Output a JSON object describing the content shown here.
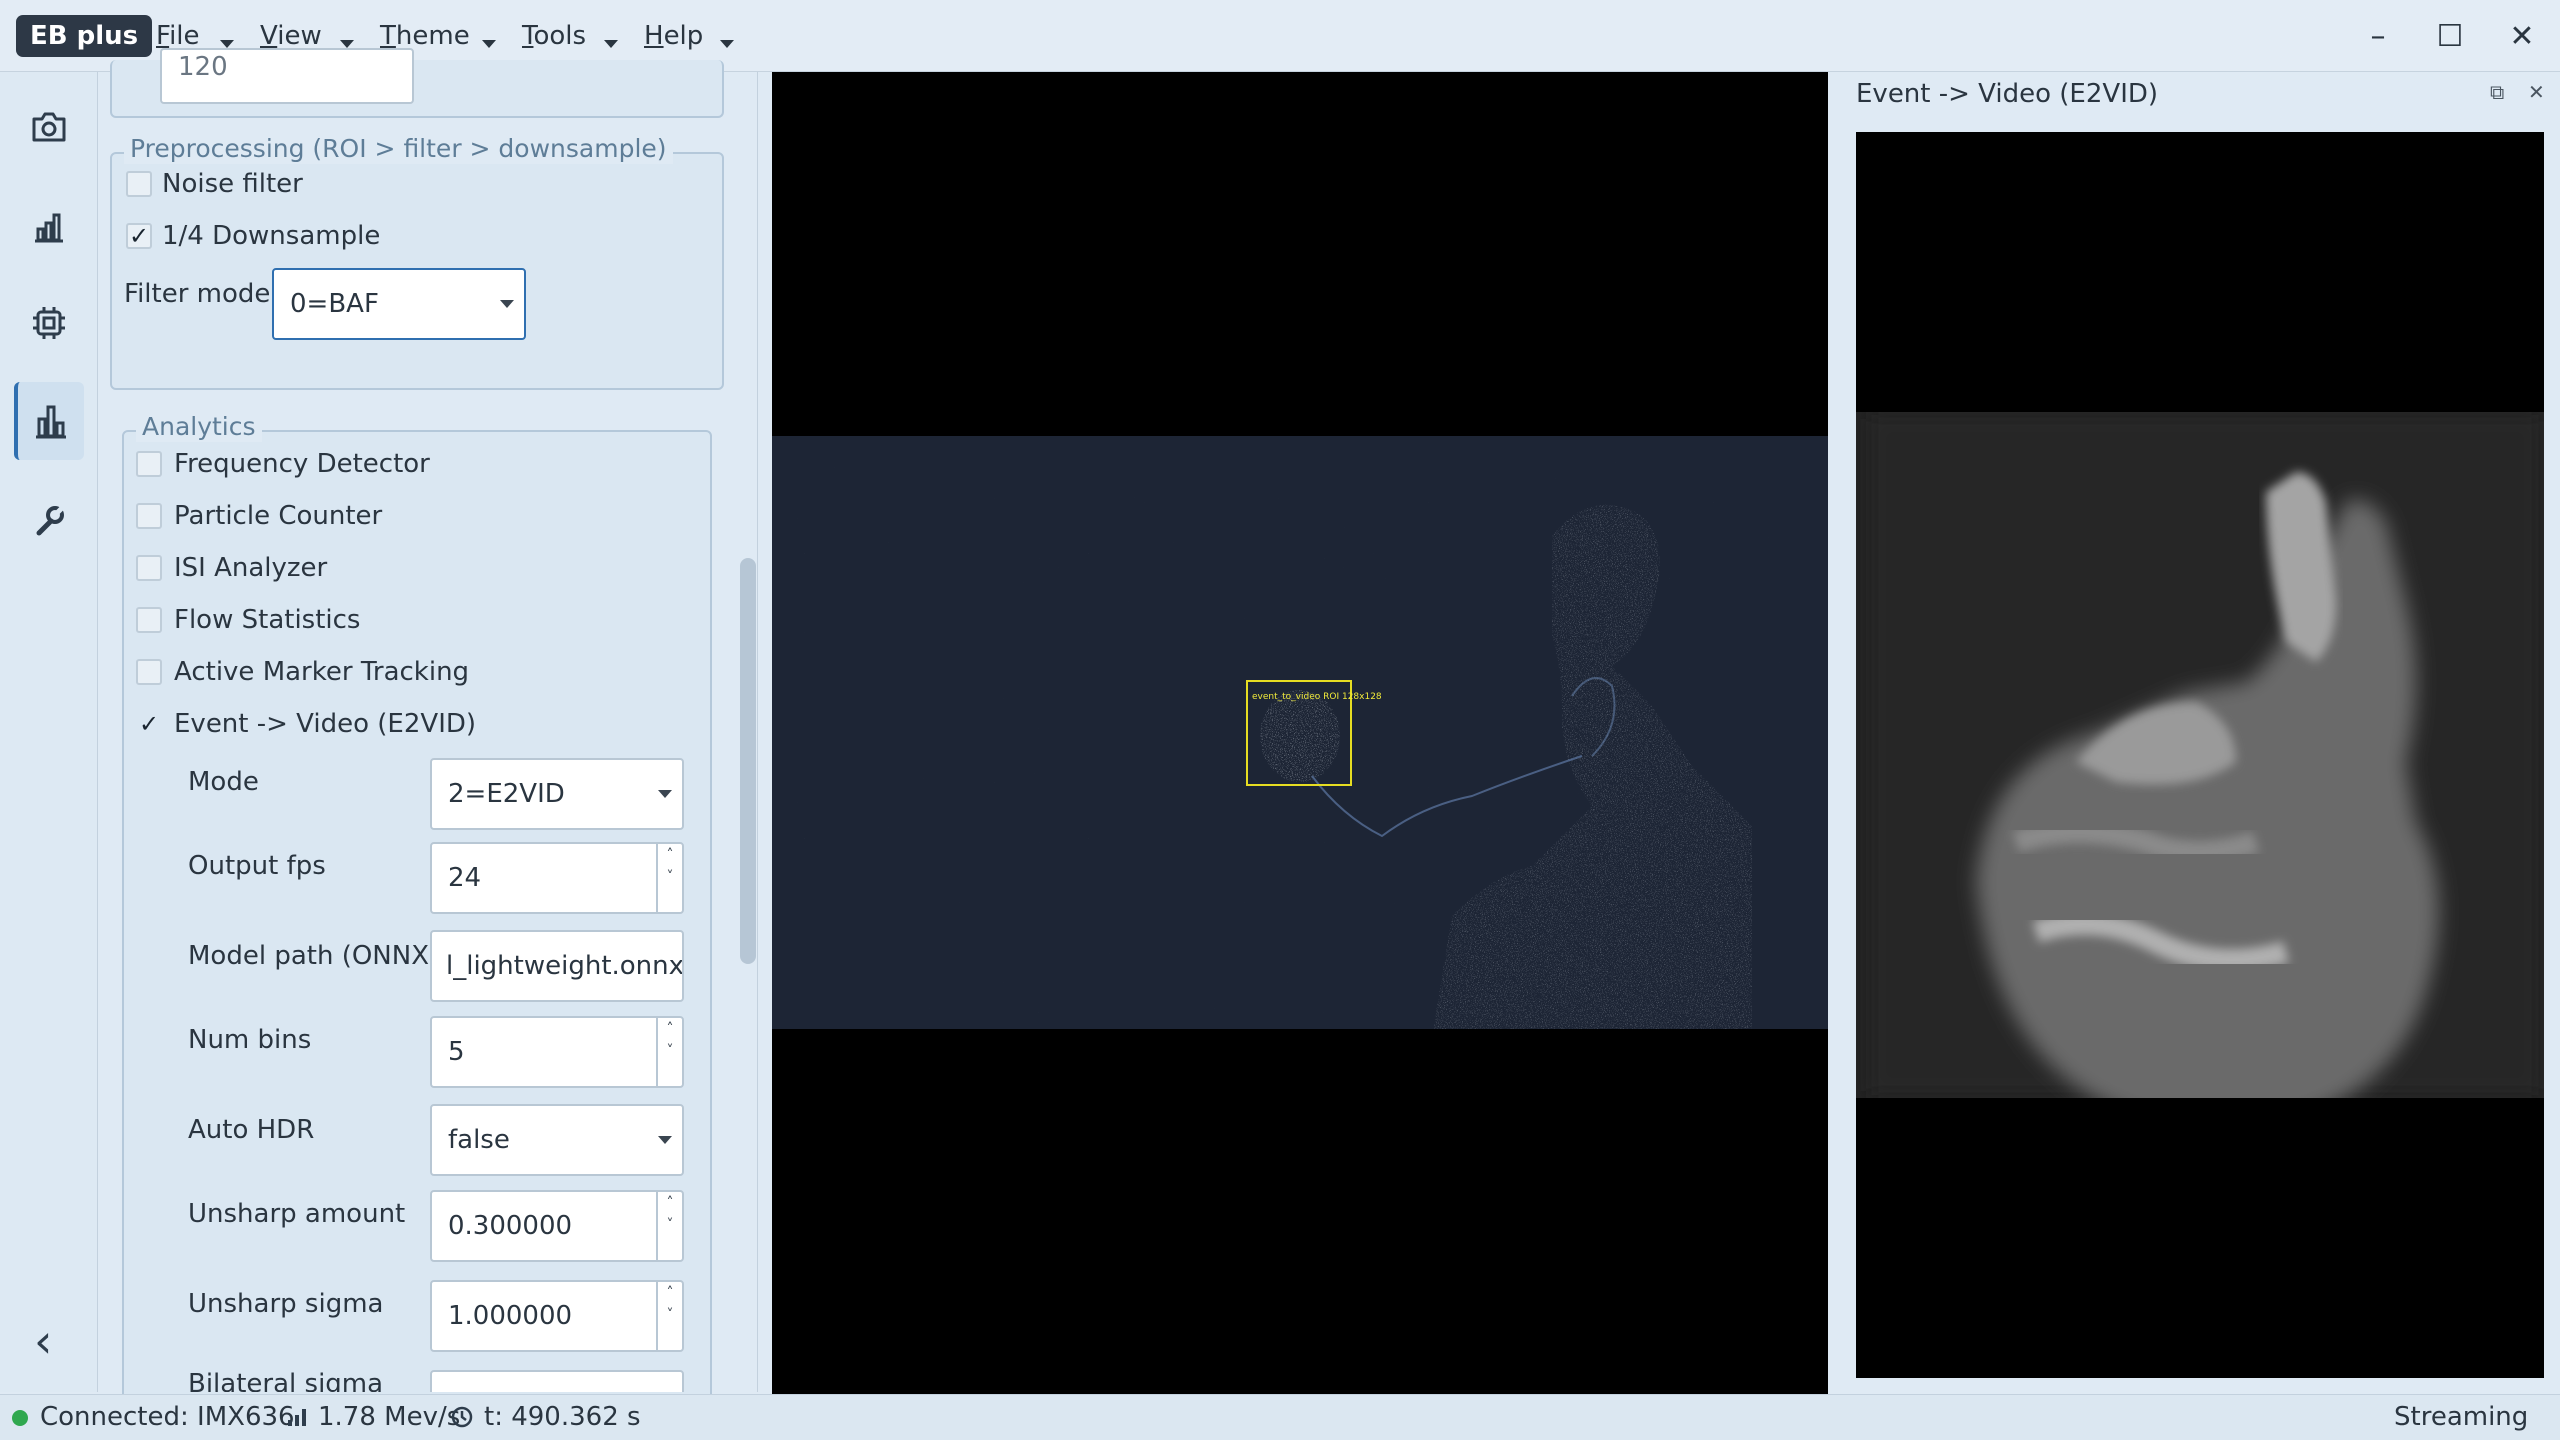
{
  "app": {
    "badge": "EB plus"
  },
  "menu": {
    "items": [
      {
        "label_u": "F",
        "label_rest": "ile"
      },
      {
        "label_u": "V",
        "label_rest": "iew"
      },
      {
        "label_u": "T",
        "label_rest": "heme"
      },
      {
        "label_u": "T",
        "label_rest": "ools"
      },
      {
        "label_u": "H",
        "label_rest": "elp"
      }
    ]
  },
  "window_controls": {
    "minimize": "–",
    "maximize": "☐",
    "close": "✕"
  },
  "rail": {
    "icons": [
      "camera-icon",
      "bar-chart-icon",
      "chip-icon",
      "analytics-icon",
      "wrench-icon"
    ],
    "active_index": 3,
    "collapse_glyph": "‹"
  },
  "panel": {
    "top_spin_value": "120",
    "preprocessing": {
      "title": "Preprocessing (ROI > filter > downsample)",
      "noise_filter": {
        "label": "Noise filter",
        "checked": false
      },
      "downsample": {
        "label": "1/4 Downsample",
        "checked": true
      },
      "filter_mode": {
        "label": "Filter mode",
        "value": "0=BAF"
      }
    },
    "analytics": {
      "title": "Analytics",
      "items": [
        {
          "label": "Frequency Detector",
          "checked": false
        },
        {
          "label": "Particle Counter",
          "checked": false
        },
        {
          "label": "ISI Analyzer",
          "checked": false
        },
        {
          "label": "Flow Statistics",
          "checked": false
        },
        {
          "label": "Active Marker Tracking",
          "checked": false
        },
        {
          "label": "Event -> Video (E2VID)",
          "checked": true
        }
      ],
      "check_glyph": "✓",
      "params": {
        "mode": {
          "label": "Mode",
          "value": "2=E2VID"
        },
        "output_fps": {
          "label": "Output fps",
          "value": "24"
        },
        "model_path": {
          "label": "Model path (ONNX)",
          "value": "l_lightweight.onnx"
        },
        "num_bins": {
          "label": "Num bins",
          "value": "5"
        },
        "auto_hdr": {
          "label": "Auto HDR",
          "value": "false"
        },
        "unsharp_amount": {
          "label": "Unsharp amount",
          "value": "0.300000"
        },
        "unsharp_sigma": {
          "label": "Unsharp sigma",
          "value": "1.000000"
        },
        "bilateral_sigma": {
          "label": "Bilateral sigma"
        }
      }
    }
  },
  "viewer": {
    "roi_label": "event_to_video ROI 128x128"
  },
  "dock": {
    "title": "Event -> Video (E2VID)",
    "float_glyph": "⧉",
    "close_glyph": "✕"
  },
  "status": {
    "connection": "Connected: IMX636",
    "rate": "1.78 Mev/s",
    "time": "t: 490.362 s",
    "state": "Streaming",
    "connection_color": "#2fa84f"
  }
}
